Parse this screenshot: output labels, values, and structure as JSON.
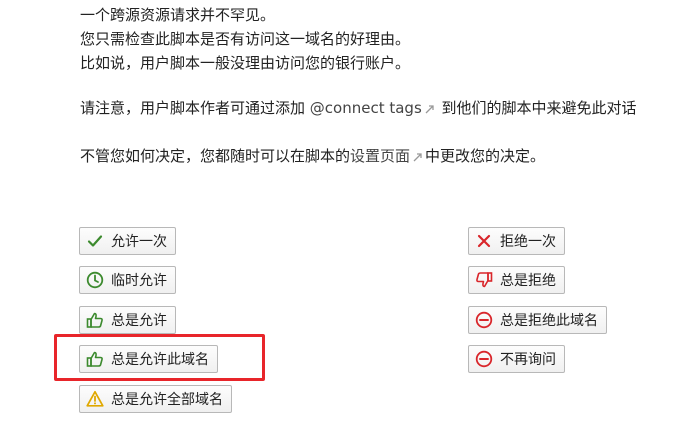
{
  "explanation": {
    "line1": "一个跨源资源请求并不罕见。",
    "line2": "您只需检查此脚本是否有访问这一域名的好理由。",
    "line3": "比如说，用户脚本一般没理由访问您的银行账户。",
    "note_prefix": "请注意，用户脚本作者可通过添加 ",
    "note_link": "@connect tags",
    "note_suffix": " 到他们的脚本中来避免此对话",
    "decide_prefix": "不管您如何决定，您都随时可以在脚本的",
    "decide_link": "设置页面",
    "decide_suffix": "中更改您的决定。"
  },
  "allow_buttons": [
    {
      "label": "允许一次",
      "icon": "check-icon"
    },
    {
      "label": "临时允许",
      "icon": "clock-icon"
    },
    {
      "label": "总是允许",
      "icon": "thumbs-up-icon"
    },
    {
      "label": "总是允许此域名",
      "icon": "thumbs-up-icon"
    },
    {
      "label": "总是允许全部域名",
      "icon": "warning-icon"
    }
  ],
  "deny_buttons": [
    {
      "label": "拒绝一次",
      "icon": "cross-icon"
    },
    {
      "label": "总是拒绝",
      "icon": "thumbs-down-icon"
    },
    {
      "label": "总是拒绝此域名",
      "icon": "minus-circle-icon"
    },
    {
      "label": "不再询问",
      "icon": "minus-circle-icon"
    }
  ],
  "colors": {
    "allow_green": "#3c8a2e",
    "deny_red": "#d9262b",
    "warning_yellow": "#e0a800",
    "highlight": "#e8252a"
  }
}
